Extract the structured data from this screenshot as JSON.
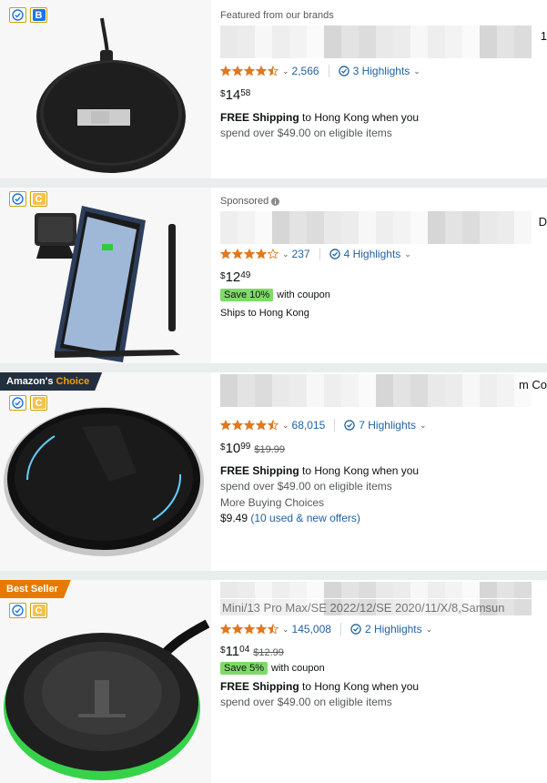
{
  "products": [
    {
      "label": "Featured from our brands",
      "title_edge": "1",
      "flag_letter": "B",
      "rating_count": "2,566",
      "highlights": "3 Highlights",
      "price": {
        "symbol": "$",
        "whole": "14",
        "fraction": "58"
      },
      "shipping": {
        "prefix": "FREE Shipping",
        "middle": " to Hong Kong when you",
        "line2": "spend over $49.00 on eligible items"
      }
    },
    {
      "label": "Sponsored",
      "title_edge": "D",
      "flag_letter": "C",
      "rating_count": "237",
      "highlights": "4 Highlights",
      "price": {
        "symbol": "$",
        "whole": "12",
        "fraction": "49"
      },
      "coupon": {
        "badge": "Save 10%",
        "text": "with coupon"
      },
      "shipping_simple": "Ships to Hong Kong"
    },
    {
      "badge_main": "Amazon's",
      "badge_accent": "Choice",
      "title_edge": "m Co",
      "flag_letter": "C",
      "rating_count": "68,015",
      "highlights": "7 Highlights",
      "price": {
        "symbol": "$",
        "whole": "10",
        "fraction": "99",
        "old": "$19.99"
      },
      "shipping": {
        "prefix": "FREE Shipping",
        "middle": " to Hong Kong when you",
        "line2": "spend over $49.00 on eligible items"
      },
      "more_buying": {
        "label": "More Buying Choices",
        "price": "$9.49",
        "offers": "(10 used & new offers)"
      }
    },
    {
      "badge_main": "Best Seller",
      "title_edge": "Mini/13 Pro Max/SE 2022/12/SE 2020/11/X/8,Samsun",
      "flag_letter": "C",
      "rating_count": "145,008",
      "highlights": "2 Highlights",
      "price": {
        "symbol": "$",
        "whole": "11",
        "fraction": "04",
        "old": "$12.99"
      },
      "coupon": {
        "badge": "Save 5%",
        "text": "with coupon"
      },
      "shipping": {
        "prefix": "FREE Shipping",
        "middle": " to Hong Kong when you",
        "line2": "spend over $49.00 on eligible items"
      }
    }
  ],
  "colors": {
    "link": "#2162a1",
    "star": "#de7921",
    "coupon": "#7fda69",
    "choice_badge": "#232f3e",
    "best_seller": "#e67a00"
  },
  "icons": [
    "check-circle-icon",
    "star-icon",
    "half-star-icon",
    "chevron-down-icon",
    "info-icon"
  ]
}
